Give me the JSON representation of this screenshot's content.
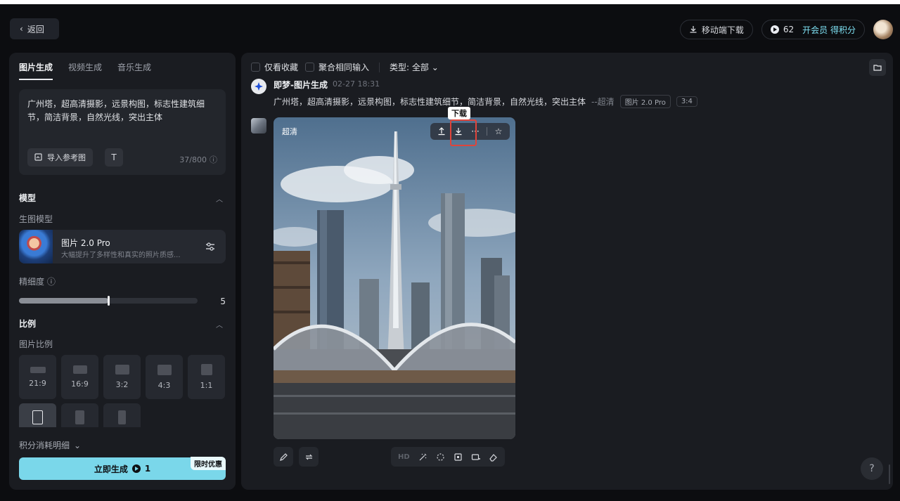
{
  "header": {
    "back_label": "返回",
    "download_label": "移动端下载",
    "credits": "62",
    "vip_label": "开会员 得积分"
  },
  "left": {
    "tabs": [
      {
        "label": "图片生成",
        "active": true
      },
      {
        "label": "视频生成",
        "active": false
      },
      {
        "label": "音乐生成",
        "active": false
      }
    ],
    "prompt": "广州塔，超高清摄影，远景构图，标志性建筑细节，简洁背景，自然光线，突出主体",
    "ref_button": "导入参考图",
    "counter": "37/800",
    "model_section": "模型",
    "model_sublabel": "生图模型",
    "model_name": "图片 2.0 Pro",
    "model_desc": "大幅提升了多样性和真实的照片质感...",
    "detail_label": "精细度",
    "detail_value": "5",
    "detail_fraction": 0.5,
    "ratio_section": "比例",
    "ratio_sublabel": "图片比例",
    "ratios": [
      "21:9",
      "16:9",
      "3:2",
      "4:3",
      "1:1"
    ],
    "consume_label": "积分消耗明细",
    "generate_label": "立即生成",
    "generate_cost": "1",
    "promo": "限时优惠"
  },
  "right": {
    "filters": {
      "favorites": "仅看收藏",
      "merge": "聚合相同输入",
      "type": "类型: 全部"
    },
    "generation": {
      "title": "即梦-图片生成",
      "time": "02-27  18:31",
      "prompt": "广州塔，超高清摄影，远景构图，标志性建筑细节，简洁背景，自然光线，突出主体",
      "quality_suffix": "--超清",
      "model_tag": "图片 2.0 Pro",
      "ratio_tag": "3:4"
    },
    "image_label": "超清",
    "tooltip": "下载",
    "hd_label": "HD",
    "help": "?"
  }
}
